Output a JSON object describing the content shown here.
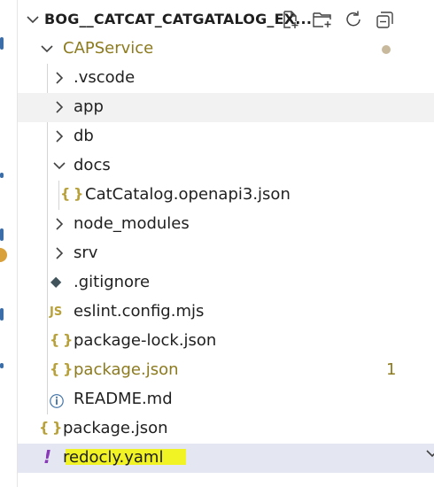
{
  "explorer": {
    "title": "BOG__CATCAT_CATGATALOG_EX...",
    "actions": [
      "new-file-icon",
      "new-folder-icon",
      "refresh-icon",
      "collapse-all-icon"
    ]
  },
  "tree": {
    "root": "CAPService",
    "vscode": ".vscode",
    "app": "app",
    "db": "db",
    "docs": "docs",
    "catcatalog": "CatCatalog.openapi3.json",
    "node_modules": "node_modules",
    "srv": "srv",
    "gitignore": ".gitignore",
    "eslint": "eslint.config.mjs",
    "package_lock": "package-lock.json",
    "package_json": "package.json",
    "package_json_problems": "1",
    "readme": "README.md",
    "outer_package_json": "package.json",
    "redocly": "redocly.yaml"
  },
  "icons": {
    "json": "{ }",
    "js": "JS",
    "info": "ⓘ",
    "yaml": "!",
    "git": "◆"
  },
  "colors": {
    "modified": "#8c7a1e",
    "selected_bg": "#e4e6f1",
    "hover_bg": "#f2f2f2",
    "highlighter": "#f4f400"
  }
}
